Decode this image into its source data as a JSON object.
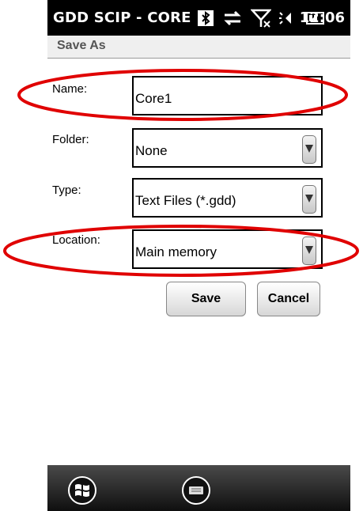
{
  "status": {
    "app_title": "GDD SCIP - CORE",
    "time": "12:06",
    "icons": [
      "bluetooth-icon",
      "data-connection-icon",
      "no-signal-icon",
      "volume-icon",
      "battery-icon"
    ]
  },
  "page": {
    "title": "Save As"
  },
  "form": {
    "name": {
      "label": "Name:",
      "value": "Core1"
    },
    "folder": {
      "label": "Folder:",
      "value": "None"
    },
    "type": {
      "label": "Type:",
      "value": "Text Files (*.gdd)"
    },
    "location": {
      "label": "Location:",
      "value": "Main memory"
    }
  },
  "buttons": {
    "save": "Save",
    "cancel": "Cancel"
  },
  "taskbar": {
    "icons": [
      "windows-start-icon",
      "keyboard-icon"
    ]
  },
  "colors": {
    "annotation": "#e00000",
    "statusbar": "#000000"
  }
}
